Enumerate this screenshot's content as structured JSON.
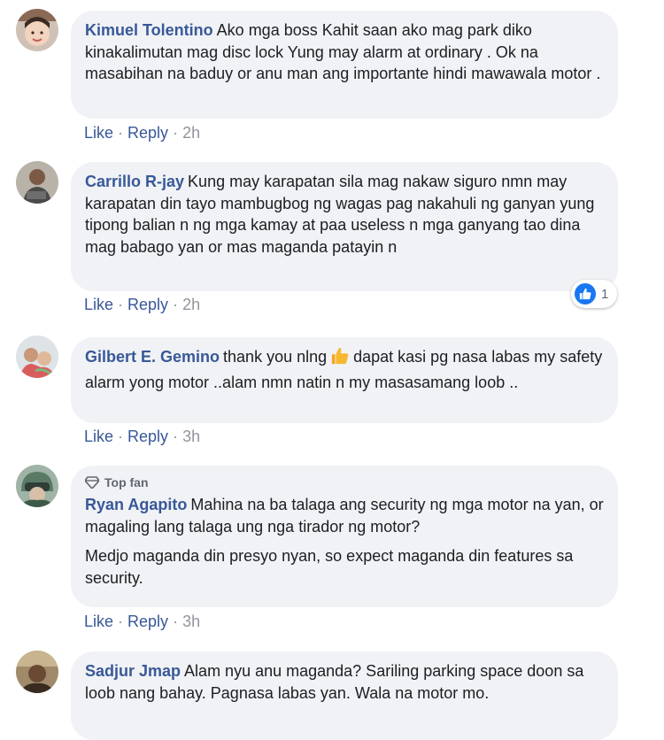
{
  "comments": [
    {
      "author": "Kimuel Tolentino",
      "text": "Ako mga boss Kahit saan ako mag park diko kinakalimutan mag disc lock Yung may alarm at ordinary . Ok na masabihan na baduy or anu man ang importante hindi mawawala motor .",
      "like": "Like",
      "reply": "Reply",
      "time": "2h"
    },
    {
      "author": "Carrillo R-jay",
      "text": "Kung may karapatan sila mag nakaw siguro nmn may karapatan din tayo mambugbog ng wagas pag nakahuli ng ganyan yung tipong balian n ng mga kamay at paa useless n mga ganyang tao dina mag babago yan or mas maganda patayin n",
      "like": "Like",
      "reply": "Reply",
      "time": "2h",
      "reaction_count": "1"
    },
    {
      "author": "Gilbert E. Gemino",
      "text_before": "thank you nlng",
      "emoji": "thumbs-up",
      "text_after": "dapat kasi pg nasa labas my safety alarm yong motor ..alam nmn natin n my masasamang loob ..",
      "like": "Like",
      "reply": "Reply",
      "time": "3h"
    },
    {
      "badge": "Top fan",
      "author": "Ryan Agapito",
      "text": "Mahina na ba talaga ang security ng mga motor na yan, or magaling lang talaga ung nga tirador ng motor?",
      "text2": "Medjo maganda din presyo nyan, so expect maganda din features sa security.",
      "like": "Like",
      "reply": "Reply",
      "time": "3h"
    },
    {
      "author": "Sadjur Jmap",
      "text": "Alam nyu anu maganda? Sariling parking space doon sa loob nang bahay. Pagnasa labas yan. Wala na motor mo."
    }
  ],
  "colors": {
    "author": "#385898",
    "bubble": "#f0f2f5",
    "like_blue": "#1877f2"
  }
}
